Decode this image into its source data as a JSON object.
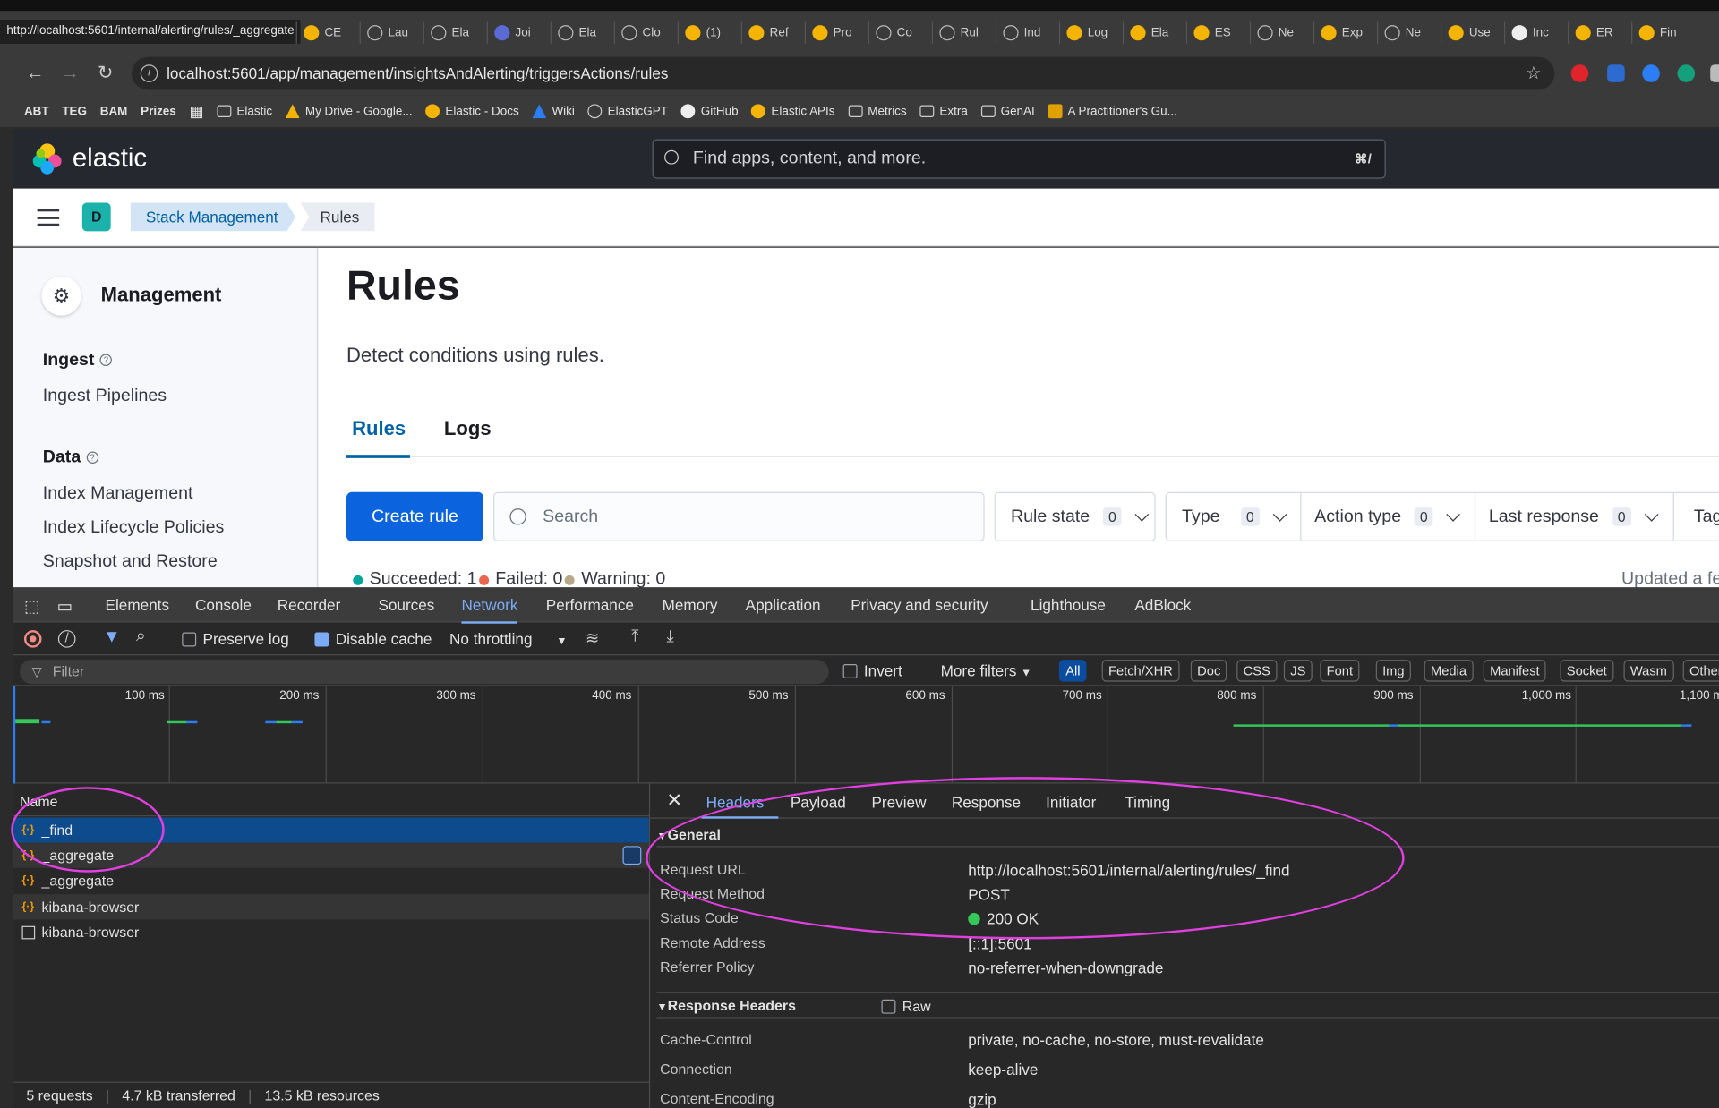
{
  "browser": {
    "url_hint": "http://localhost:5601/internal/alerting/rules/_aggregate",
    "tabs": [
      "CE",
      "Lau",
      "Ela",
      "Joi",
      "Ela",
      "Clo",
      "(1)",
      "Ref",
      "Pro",
      "Co",
      "Rul",
      "Ind",
      "Log",
      "Ela",
      "ES",
      "Ne",
      "Exp",
      "Ne",
      "Use",
      "Inc",
      "ER",
      "Fin"
    ],
    "address": "localhost:5601/app/management/insightsAndAlerting/triggersActions/rules",
    "bookmarks": [
      "ABT",
      "TEG",
      "BAM",
      "Prizes",
      "Elastic",
      "My Drive - Google...",
      "Elastic - Docs",
      "Wiki",
      "ElasticGPT",
      "GitHub",
      "Elastic APIs",
      "Metrics",
      "Extra",
      "GenAI",
      "A Practitioner's Gu..."
    ]
  },
  "kibana": {
    "logo": "elastic",
    "search_placeholder": "Find apps, content, and more.",
    "search_shortcut": "⌘/",
    "avatar": "D",
    "breadcrumbs": [
      "Stack Management",
      "Rules"
    ],
    "sidebar": {
      "title": "Management",
      "groups": [
        {
          "label": "Ingest",
          "items": [
            "Ingest Pipelines"
          ]
        },
        {
          "label": "Data",
          "items": [
            "Index Management",
            "Index Lifecycle Policies",
            "Snapshot and Restore"
          ]
        }
      ]
    },
    "page": {
      "title": "Rules",
      "description": "Detect conditions using rules.",
      "tabs": [
        "Rules",
        "Logs"
      ],
      "create_button": "Create rule",
      "search_placeholder": "Search",
      "filters": [
        {
          "label": "Rule state",
          "count": "0"
        },
        {
          "label": "Type",
          "count": "0"
        },
        {
          "label": "Action type",
          "count": "0"
        },
        {
          "label": "Last response",
          "count": "0"
        },
        {
          "label": "Tag",
          "count": ""
        }
      ],
      "status": {
        "succeeded": "Succeeded: 1",
        "failed": "Failed: 0",
        "warning": "Warning: 0"
      },
      "updated": "Updated a fe",
      "colors": {
        "succeeded": "#00a69b",
        "failed": "#e7664c",
        "warning": "#b9a888"
      }
    }
  },
  "devtools": {
    "tabs": [
      "Elements",
      "Console",
      "Recorder",
      "Sources",
      "Network",
      "Performance",
      "Memory",
      "Application",
      "Privacy and security",
      "Lighthouse",
      "AdBlock"
    ],
    "active_tab": "Network",
    "preserve_log": "Preserve log",
    "disable_cache": "Disable cache",
    "throttling": "No throttling",
    "filter_placeholder": "Filter",
    "invert": "Invert",
    "more_filters": "More filters",
    "types": [
      "All",
      "Fetch/XHR",
      "Doc",
      "CSS",
      "JS",
      "Font",
      "Img",
      "Media",
      "Manifest",
      "Socket",
      "Wasm",
      "Other"
    ],
    "timeline_labels": [
      "100 ms",
      "200 ms",
      "300 ms",
      "400 ms",
      "500 ms",
      "600 ms",
      "700 ms",
      "800 ms",
      "900 ms",
      "1,000 ms",
      "1,100 m"
    ],
    "list_header": "Name",
    "requests": [
      "_find",
      "_aggregate",
      "_aggregate",
      "kibana-browser",
      "kibana-browser"
    ],
    "footer": {
      "requests": "5 requests",
      "transferred": "4.7 kB transferred",
      "resources": "13.5 kB resources"
    },
    "detail_tabs": [
      "Headers",
      "Payload",
      "Preview",
      "Response",
      "Initiator",
      "Timing"
    ],
    "general_label": "General",
    "general": [
      {
        "k": "Request URL",
        "v": "http://localhost:5601/internal/alerting/rules/_find"
      },
      {
        "k": "Request Method",
        "v": "POST"
      },
      {
        "k": "Status Code",
        "v": "200 OK"
      },
      {
        "k": "Remote Address",
        "v": "[::1]:5601"
      },
      {
        "k": "Referrer Policy",
        "v": "no-referrer-when-downgrade"
      }
    ],
    "response_headers_label": "Response Headers",
    "raw_label": "Raw",
    "response_headers": [
      {
        "k": "Cache-Control",
        "v": "private, no-cache, no-store, must-revalidate"
      },
      {
        "k": "Connection",
        "v": "keep-alive"
      },
      {
        "k": "Content-Encoding",
        "v": "gzip"
      }
    ]
  }
}
